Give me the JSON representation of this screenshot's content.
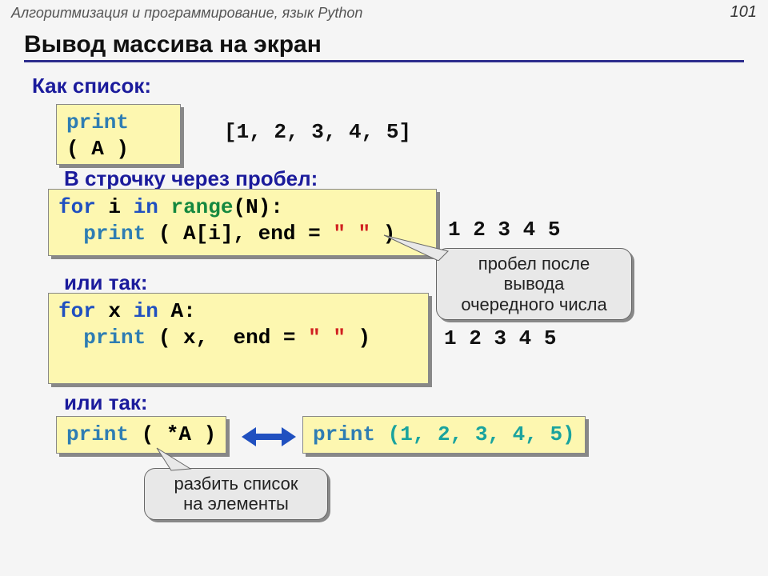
{
  "header": "Алгоритмизация и программирование, язык Python",
  "page": "101",
  "title": "Вывод массива на экран",
  "sect1": "Как список:",
  "sect2": "В строчку через пробел:",
  "sect3": "или так:",
  "sect4": "или так:",
  "out_list": "[1, 2, 3, 4, 5]",
  "out_line1": "1 2 3 4 5",
  "out_line2": "1 2 3 4 5",
  "tokens": {
    "print": "print",
    "for": "for",
    "in": "in",
    "range": "range",
    "end": "end",
    "openA": "( A )",
    "i": "i",
    "N": "(N):",
    "Ai": "( A[i],",
    "eq": "=",
    "sp": "\" \"",
    "cp": ")",
    "x": "x",
    "A_colon": "A:",
    "x_comma": "(  x,",
    "end_eq": "= ",
    "star": "( *A )",
    "nums": "(1, 2, 3, 4, 5)"
  },
  "callout1_l1": "пробел после",
  "callout1_l2": "вывода",
  "callout1_l3": "очередного числа",
  "callout2_l1": "разбить список",
  "callout2_l2": "на элементы"
}
